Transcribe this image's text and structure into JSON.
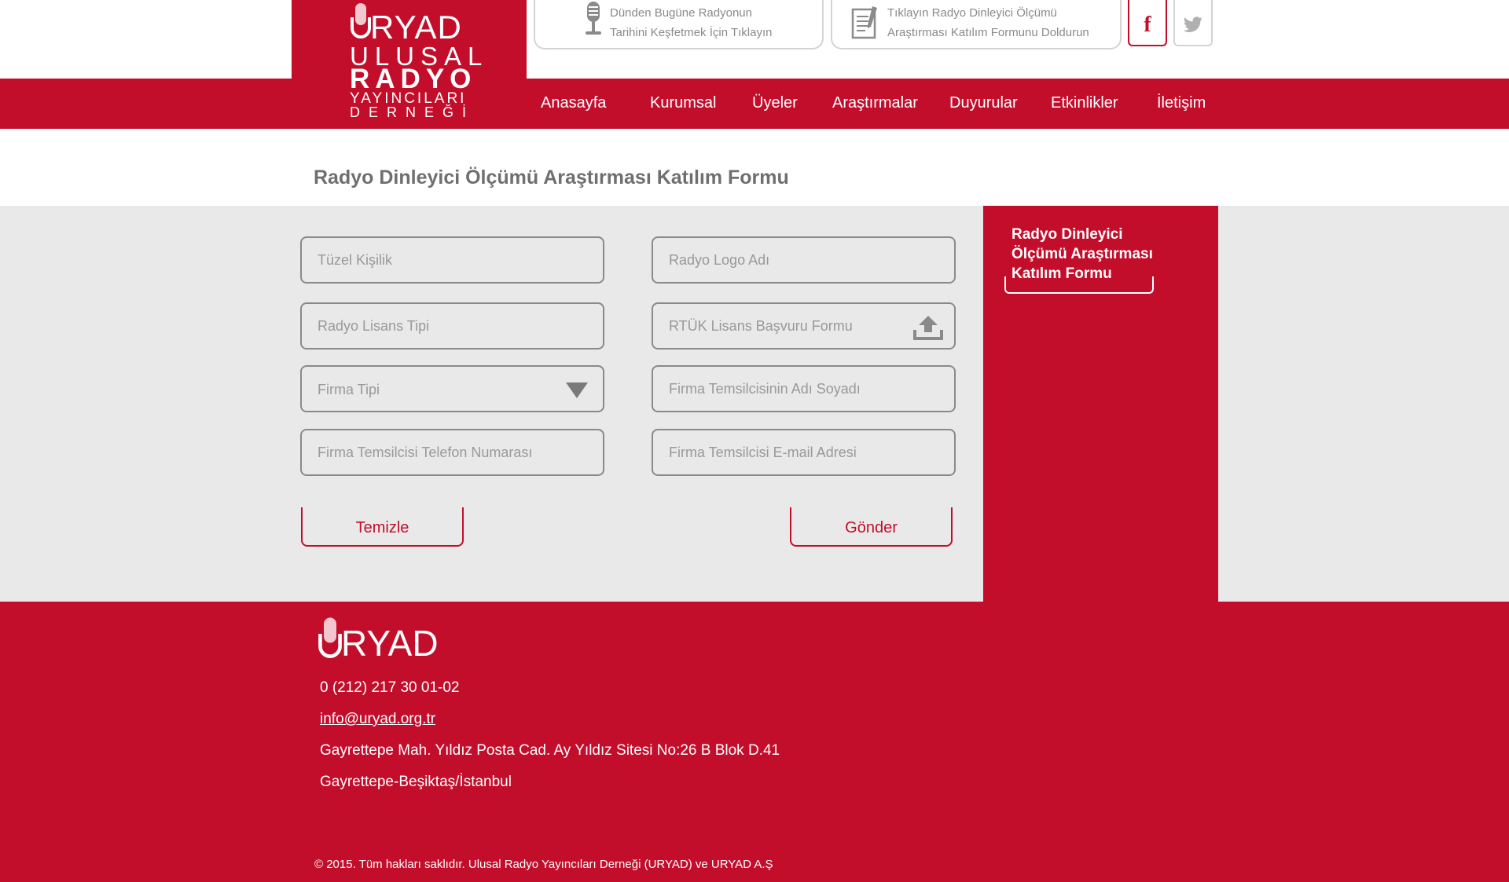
{
  "logo": {
    "word": "RYAD",
    "line1": "ULUSAL",
    "line2": "RADYO",
    "line3": "YAYINCILARI",
    "line4": "DERNEĞİ"
  },
  "top_links": {
    "history_line1": "Dünden Bugüne Radyonun",
    "history_line2": "Tarihini Keşfetmek İçin Tıklayın",
    "form_line1": "Tıklayın Radyo Dinleyici Ölçümü",
    "form_line2": "Araştırması Katılım Formunu Doldurun"
  },
  "social": {
    "facebook_glyph": "f"
  },
  "nav": [
    "Anasayfa",
    "Kurumsal",
    "Üyeler",
    "Araştırmalar",
    "Duyurular",
    "Etkinlikler",
    "İletişim"
  ],
  "page_title": "Radyo Dinleyici Ölçümü Araştırması Katılım Formu",
  "form": {
    "tuzel_kisilik": "Tüzel Kişilik",
    "radyo_logo_adi": "Radyo Logo Adı",
    "radyo_lisans_tipi": "Radyo Lisans Tipi",
    "rtuk_formu": "RTÜK Lisans Başvuru Formu",
    "firma_tipi": "Firma Tipi",
    "temsilci_ad_soyad": "Firma Temsilcisinin Adı Soyadı",
    "temsilci_telefon": "Firma Temsilcisi Telefon Numarası",
    "temsilci_email": "Firma Temsilcisi E-mail Adresi",
    "clear_label": "Temizle",
    "submit_label": "Gönder"
  },
  "sidebar": {
    "active_item": "Radyo Dinleyici Ölçümü Araştırması Katılım Formu"
  },
  "footer": {
    "logo_word": "RYAD",
    "phone": "0 (212) 217 30 01-02",
    "email": "info@uryad.org.tr",
    "address1": "Gayrettepe Mah. Yıldız Posta Cad. Ay Yıldız Sitesi No:26 B Blok D.41",
    "address2": "Gayrettepe-Beşiktaş/İstanbul",
    "copyright": "© 2015. Tüm hakları saklıdır. Ulusal Radyo Yayıncıları Derneği (URYAD) ve URYAD A.Ş"
  },
  "colors": {
    "brand_red": "#c20e2b",
    "form_bg": "#e9e9e9",
    "border_gray": "#8a8a8a",
    "title_gray": "#6f6f6f"
  },
  "icons": [
    "microphone-icon",
    "document-edit-icon",
    "facebook-icon",
    "twitter-icon",
    "upload-icon",
    "dropdown-arrow-icon"
  ]
}
